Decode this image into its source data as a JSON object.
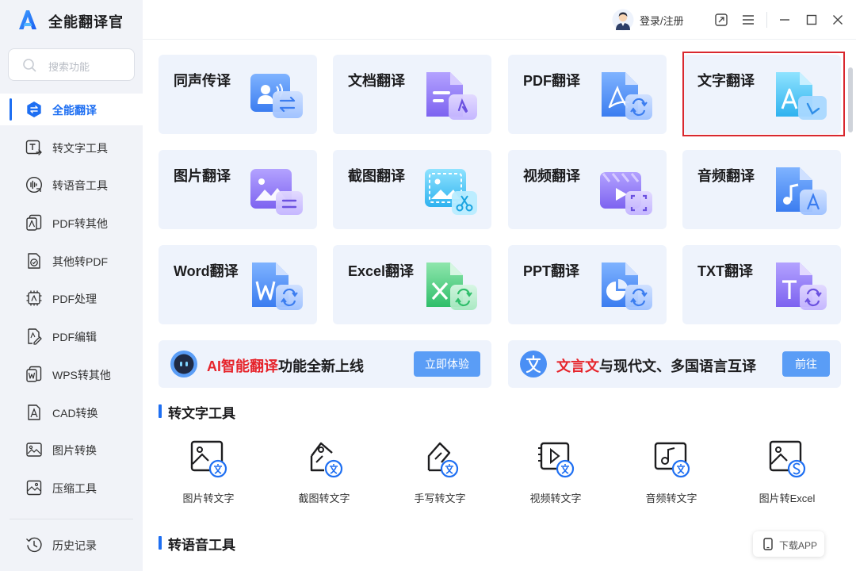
{
  "app": {
    "title": "全能翻译官"
  },
  "search": {
    "placeholder": "搜索功能"
  },
  "sidebar": {
    "items": [
      {
        "label": "全能翻译",
        "icon": "translate-icon",
        "active": true
      },
      {
        "label": "转文字工具",
        "icon": "text-tool-icon"
      },
      {
        "label": "转语音工具",
        "icon": "voice-tool-icon"
      },
      {
        "label": "PDF转其他",
        "icon": "pdf-convert-icon"
      },
      {
        "label": "其他转PDF",
        "icon": "to-pdf-icon"
      },
      {
        "label": "PDF处理",
        "icon": "pdf-process-icon"
      },
      {
        "label": "PDF编辑",
        "icon": "pdf-edit-icon"
      },
      {
        "label": "WPS转其他",
        "icon": "wps-convert-icon"
      },
      {
        "label": "CAD转换",
        "icon": "cad-convert-icon"
      },
      {
        "label": "图片转换",
        "icon": "image-convert-icon"
      },
      {
        "label": "压缩工具",
        "icon": "compress-icon"
      }
    ],
    "history": {
      "label": "历史记录",
      "icon": "history-icon"
    }
  },
  "header": {
    "login_label": "登录/注册"
  },
  "cards": [
    {
      "label": "同声传译",
      "icon": "simultaneous-interpretation-icon"
    },
    {
      "label": "文档翻译",
      "icon": "document-translate-icon"
    },
    {
      "label": "PDF翻译",
      "icon": "pdf-translate-icon"
    },
    {
      "label": "文字翻译",
      "icon": "text-translate-icon",
      "highlighted": true
    },
    {
      "label": "图片翻译",
      "icon": "image-translate-icon"
    },
    {
      "label": "截图翻译",
      "icon": "screenshot-translate-icon"
    },
    {
      "label": "视频翻译",
      "icon": "video-translate-icon"
    },
    {
      "label": "音频翻译",
      "icon": "audio-translate-icon"
    },
    {
      "label": "Word翻译",
      "icon": "word-translate-icon"
    },
    {
      "label": "Excel翻译",
      "icon": "excel-translate-icon"
    },
    {
      "label": "PPT翻译",
      "icon": "ppt-translate-icon"
    },
    {
      "label": "TXT翻译",
      "icon": "txt-translate-icon"
    }
  ],
  "banners": [
    {
      "red": "AI智能翻译",
      "rest": "功能全新上线",
      "button": "立即体验",
      "icon": "robot-icon"
    },
    {
      "red": "文言文",
      "rest": "与现代文、多国语言互译",
      "button": "前往",
      "icon": "wen-icon"
    }
  ],
  "sections": {
    "text_tools": {
      "title": "转文字工具",
      "items": [
        {
          "label": "图片转文字",
          "icon": "image-to-text-icon"
        },
        {
          "label": "截图转文字",
          "icon": "screenshot-to-text-icon"
        },
        {
          "label": "手写转文字",
          "icon": "handwriting-to-text-icon"
        },
        {
          "label": "视频转文字",
          "icon": "video-to-text-icon"
        },
        {
          "label": "音频转文字",
          "icon": "audio-to-text-icon"
        },
        {
          "label": "图片转Excel",
          "icon": "image-to-excel-icon"
        }
      ]
    },
    "voice_tools": {
      "title": "转语音工具"
    }
  },
  "download": {
    "label": "下载APP"
  },
  "colors": {
    "accent": "#1e6ff2",
    "highlight_border": "#d9272e",
    "card_bg": "#eef3fc",
    "sidebar_bg": "#f1f3f8",
    "button_bg": "#5a9df6"
  }
}
